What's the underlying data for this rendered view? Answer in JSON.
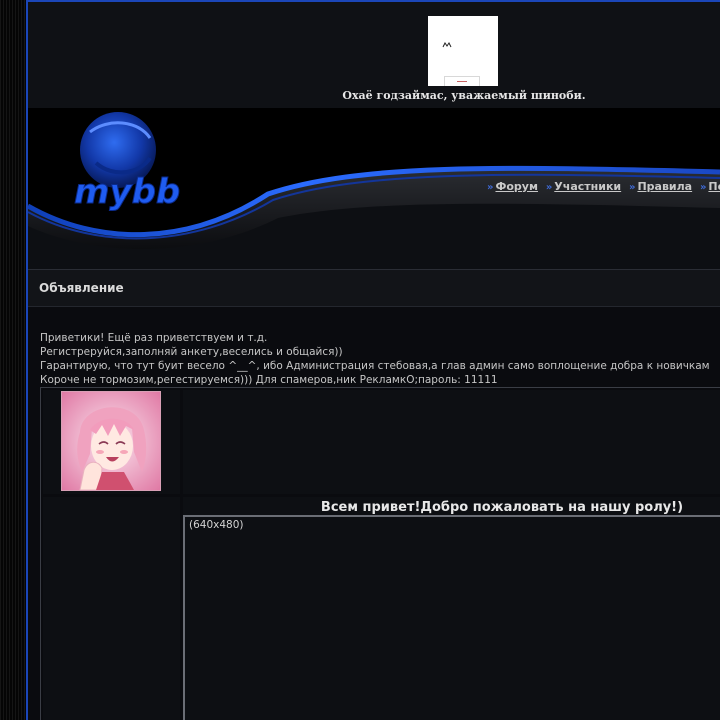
{
  "banner": {
    "welcome": "Охаё годзаймас, уважаемый шиноби.",
    "logo_icon": "banner-logo-icon"
  },
  "header": {
    "logo_text": "mybb",
    "nav": [
      {
        "label": "Форум"
      },
      {
        "label": "Участники"
      },
      {
        "label": "Правила"
      },
      {
        "label": "По"
      }
    ]
  },
  "announcement": {
    "title": "Объявление",
    "lines": [
      "Приветики! Ещё раз приветствуем и т.д.",
      "Регистреруйся,заполняй анкету,веселись и общайся))",
      "Гарантирую, что тут буит весело ^__^, ибо Администрация стебовая,а глав админ само воплощение добра к новичкам",
      "Короче не тормозим,регестируемся))) Для спамеров,ник РекламкО;пароль: 11111"
    ],
    "greeting": "Всем привет!Добро пожаловать на нашу ролу!)",
    "media_size": "(640x480)"
  },
  "colors": {
    "accent": "#1b46b8",
    "nav_separator": "#3f6bd8",
    "background": "#0a0b0f"
  }
}
